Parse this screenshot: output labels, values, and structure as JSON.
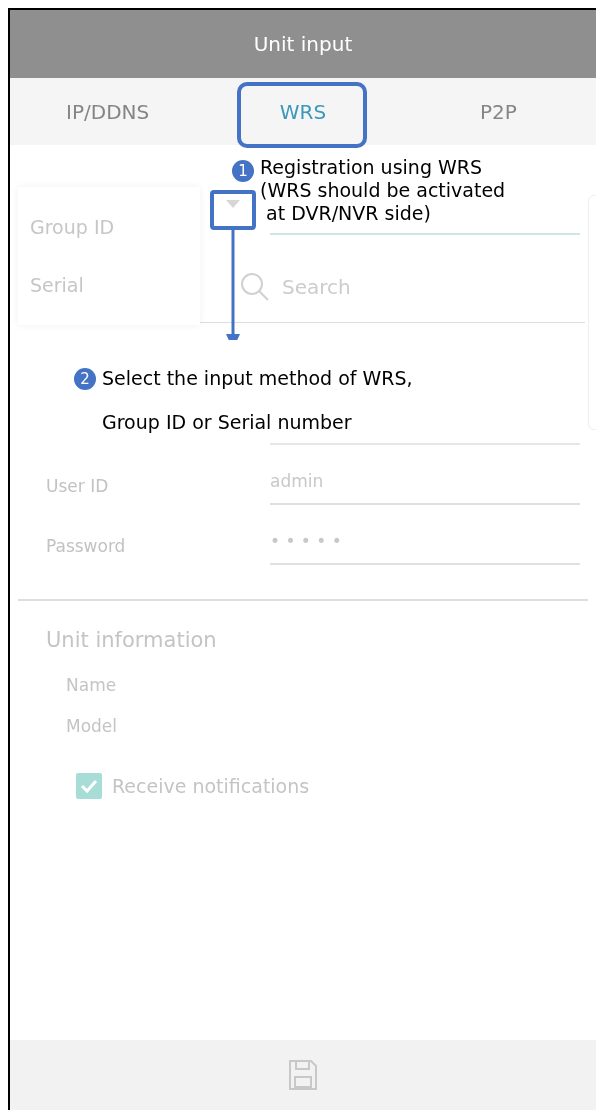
{
  "header": {
    "title": "Unit input"
  },
  "tabs": [
    {
      "label": "IP/DDNS",
      "selected": false
    },
    {
      "label": "WRS",
      "selected": true
    },
    {
      "label": "P2P",
      "selected": false
    }
  ],
  "id_type_menu": {
    "options": [
      "Group ID",
      "Serial"
    ]
  },
  "search": {
    "placeholder": "Search"
  },
  "login": [
    {
      "label": "User ID",
      "value": "admin"
    },
    {
      "label": "Password",
      "value": "• • • • •"
    }
  ],
  "unit_info": {
    "title": "Unit information",
    "fields": [
      "Name",
      "Model"
    ]
  },
  "notifications": {
    "label": "Receive notifications",
    "checked": true
  },
  "annotations": [
    {
      "number": "1",
      "lines": [
        "Registration using WRS",
        "(WRS should be activated",
        " at DVR/NVR side)"
      ]
    },
    {
      "number": "2",
      "lines": [
        "Select the input method of WRS,",
        "Group ID or Serial number"
      ]
    }
  ]
}
